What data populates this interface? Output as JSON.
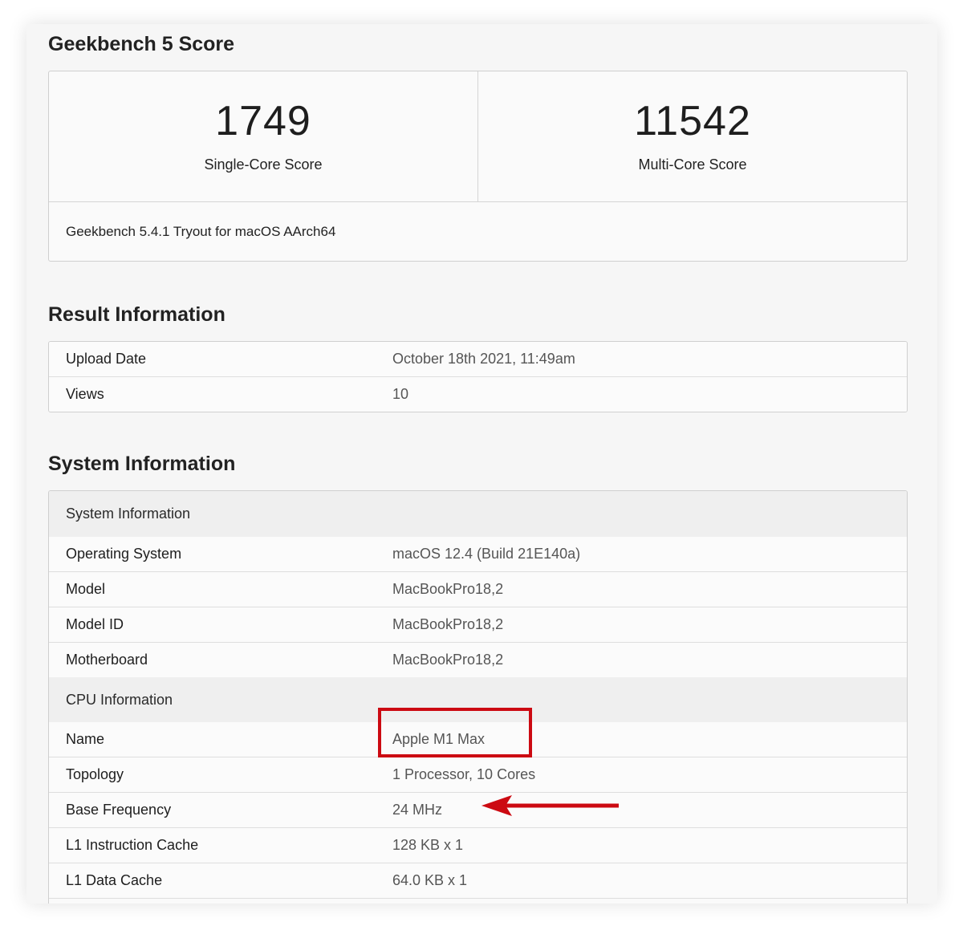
{
  "score_section": {
    "title": "Geekbench 5 Score",
    "single_core_value": "1749",
    "single_core_label": "Single-Core Score",
    "multi_core_value": "11542",
    "multi_core_label": "Multi-Core Score",
    "version": "Geekbench 5.4.1 Tryout for macOS AArch64"
  },
  "result_section": {
    "title": "Result Information",
    "rows": [
      {
        "key": "Upload Date",
        "value": "October 18th 2021, 11:49am"
      },
      {
        "key": "Views",
        "value": "10"
      }
    ]
  },
  "system_section": {
    "title": "System Information",
    "groups": [
      {
        "heading": "System Information",
        "rows": [
          {
            "key": "Operating System",
            "value": "macOS 12.4 (Build 21E140a)"
          },
          {
            "key": "Model",
            "value": "MacBookPro18,2"
          },
          {
            "key": "Model ID",
            "value": "MacBookPro18,2"
          },
          {
            "key": "Motherboard",
            "value": "MacBookPro18,2"
          }
        ]
      },
      {
        "heading": "CPU Information",
        "rows": [
          {
            "key": "Name",
            "value": "Apple M1 Max"
          },
          {
            "key": "Topology",
            "value": "1 Processor, 10 Cores"
          },
          {
            "key": "Base Frequency",
            "value": "24 MHz"
          },
          {
            "key": "L1 Instruction Cache",
            "value": "128 KB x 1"
          },
          {
            "key": "L1 Data Cache",
            "value": "64.0 KB x 1"
          }
        ]
      }
    ]
  },
  "annotations": {
    "color": "#cc0a12",
    "highlight_target": "Apple M1 Max",
    "arrow_target": "24 MHz",
    "arrow_icon": "arrow-left-icon"
  }
}
